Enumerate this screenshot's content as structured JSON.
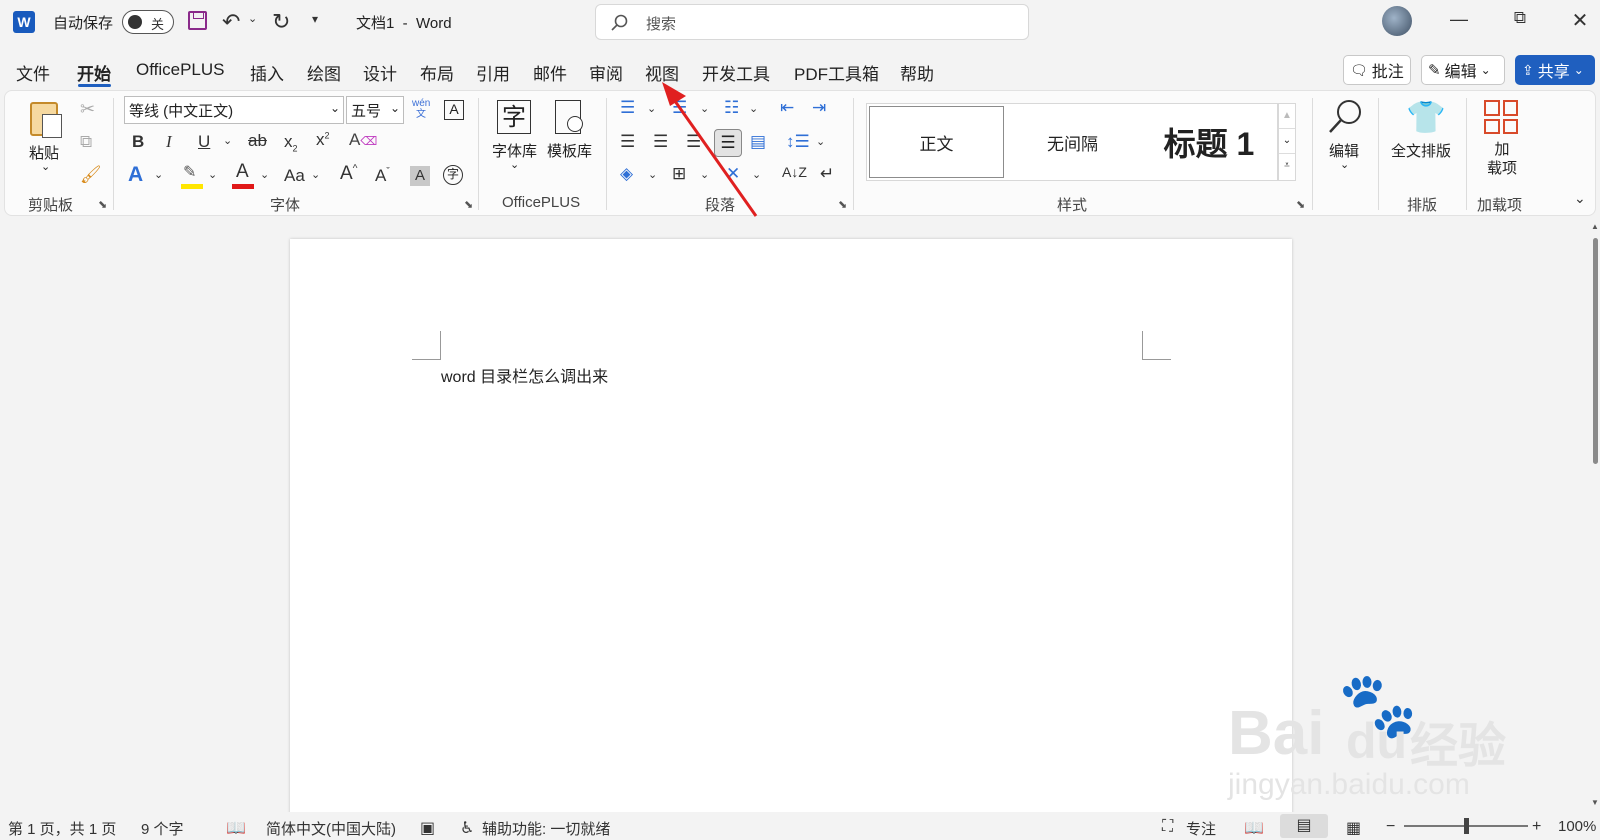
{
  "titlebar": {
    "autosave_label": "自动保存",
    "autosave_state": "关",
    "doc_title": "文档1  -  Word",
    "search_placeholder": "搜索"
  },
  "menu": {
    "tabs": [
      "文件",
      "开始",
      "OfficePLUS",
      "插入",
      "绘图",
      "设计",
      "布局",
      "引用",
      "邮件",
      "审阅",
      "视图",
      "开发工具",
      "PDF工具箱",
      "帮助"
    ],
    "active": "开始",
    "comment_btn": "批注",
    "edit_btn": "编辑",
    "share_btn": "共享"
  },
  "ribbon": {
    "clipboard": {
      "paste": "粘贴",
      "group": "剪贴板"
    },
    "font": {
      "name": "等线 (中文正文)",
      "size": "五号",
      "group": "字体",
      "phonetic": "wén\n文"
    },
    "officeplus": {
      "font_lib": "字体库",
      "template_lib": "模板库",
      "group": "OfficePLUS"
    },
    "paragraph": {
      "group": "段落"
    },
    "styles": {
      "items": [
        "正文",
        "无间隔",
        "标题 1"
      ],
      "group": "样式"
    },
    "editing": {
      "label": "编辑"
    },
    "layout": {
      "label": "全文排版",
      "group": "排版"
    },
    "addins": {
      "label": "加\n载项",
      "group": "加载项"
    }
  },
  "document": {
    "text": "word 目录栏怎么调出来"
  },
  "status": {
    "page": "第 1 页，共 1 页",
    "words": "9 个字",
    "language": "简体中文(中国大陆)",
    "accessibility": "辅助功能: 一切就绪",
    "focus": "专注",
    "zoom": "100%"
  },
  "watermark": {
    "brand": "Bai",
    "brand2": "经验",
    "url": "jingyan.baidu.com"
  },
  "colors": {
    "accent": "#1f5fbf",
    "arrow": "#e02020",
    "word_blue": "#185abd"
  }
}
